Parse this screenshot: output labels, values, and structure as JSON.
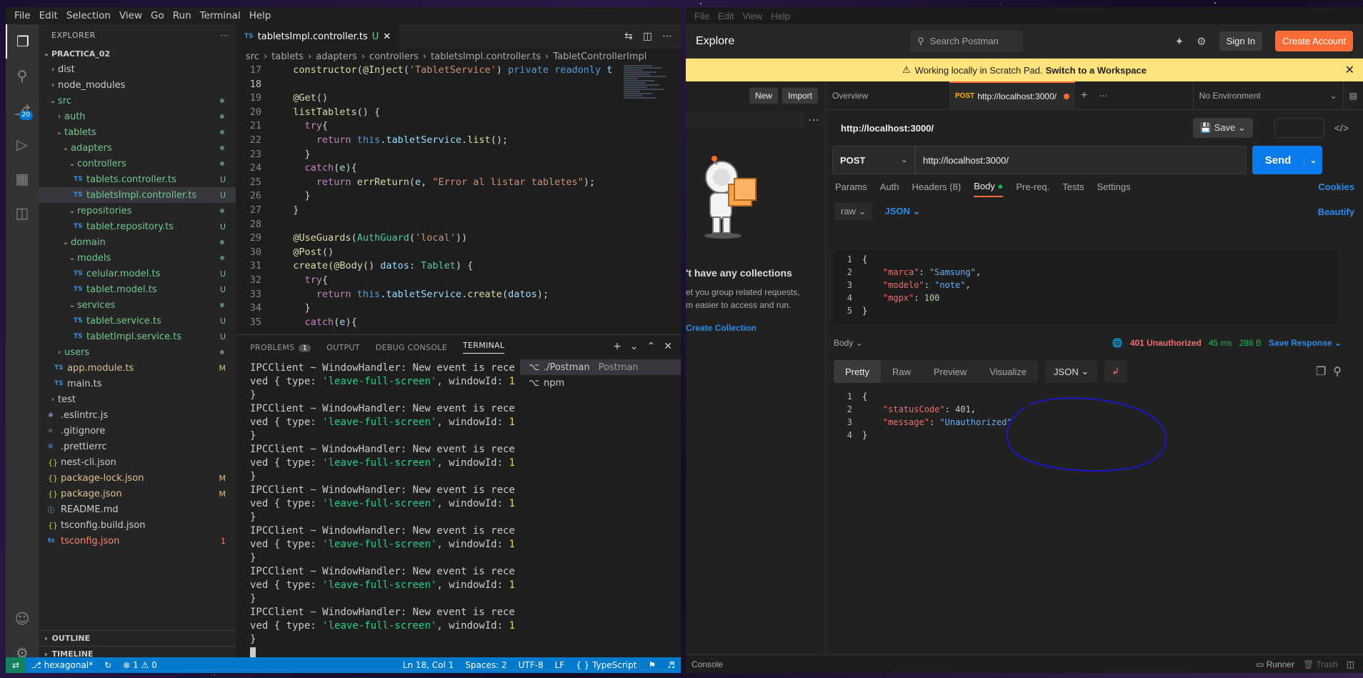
{
  "vscode": {
    "menu": [
      "File",
      "Edit",
      "Selection",
      "View",
      "Go",
      "Run",
      "Terminal",
      "Help"
    ],
    "activity_badge": "20",
    "explorer": {
      "title": "EXPLORER",
      "project": "PRACTICA_02",
      "items": [
        {
          "label": "dist",
          "indent": 1,
          "kind": "folder",
          "open": false,
          "color": "white",
          "status": ""
        },
        {
          "label": "node_modules",
          "indent": 1,
          "kind": "folder",
          "open": false,
          "color": "white",
          "status": ""
        },
        {
          "label": "src",
          "indent": 1,
          "kind": "folder",
          "open": true,
          "color": "green",
          "status": "dot"
        },
        {
          "label": "auth",
          "indent": 2,
          "kind": "folder",
          "open": false,
          "color": "green",
          "status": "dot"
        },
        {
          "label": "tablets",
          "indent": 2,
          "kind": "folder",
          "open": true,
          "color": "green",
          "status": "dot"
        },
        {
          "label": "adapters",
          "indent": 3,
          "kind": "folder",
          "open": true,
          "color": "green",
          "status": "dot"
        },
        {
          "label": "controllers",
          "indent": 4,
          "kind": "folder",
          "open": true,
          "color": "green",
          "status": "dot"
        },
        {
          "label": "tablets.controller.ts",
          "indent": 5,
          "kind": "ts",
          "color": "green",
          "status": "U"
        },
        {
          "label": "tabletsImpl.controller.ts",
          "indent": 5,
          "kind": "ts",
          "color": "green",
          "status": "U",
          "selected": true
        },
        {
          "label": "repositories",
          "indent": 4,
          "kind": "folder",
          "open": true,
          "color": "green",
          "status": "dot"
        },
        {
          "label": "tablet.repository.ts",
          "indent": 5,
          "kind": "ts",
          "color": "green",
          "status": "U"
        },
        {
          "label": "domain",
          "indent": 3,
          "kind": "folder",
          "open": true,
          "color": "green",
          "status": "dot"
        },
        {
          "label": "models",
          "indent": 4,
          "kind": "folder",
          "open": true,
          "color": "green",
          "status": "dot"
        },
        {
          "label": "celular.model.ts",
          "indent": 5,
          "kind": "ts",
          "color": "green",
          "status": "U"
        },
        {
          "label": "tablet.model.ts",
          "indent": 5,
          "kind": "ts",
          "color": "green",
          "status": "U"
        },
        {
          "label": "services",
          "indent": 4,
          "kind": "folder",
          "open": true,
          "color": "green",
          "status": "dot"
        },
        {
          "label": "tablet.service.ts",
          "indent": 5,
          "kind": "ts",
          "color": "green",
          "status": "U"
        },
        {
          "label": "tabletImpl.service.ts",
          "indent": 5,
          "kind": "ts",
          "color": "green",
          "status": "U"
        },
        {
          "label": "users",
          "indent": 2,
          "kind": "folder",
          "open": false,
          "color": "green",
          "status": "dot"
        },
        {
          "label": "app.module.ts",
          "indent": 2,
          "kind": "ts",
          "color": "yellow",
          "status": "M"
        },
        {
          "label": "main.ts",
          "indent": 2,
          "kind": "ts",
          "color": "white",
          "status": ""
        },
        {
          "label": "test",
          "indent": 1,
          "kind": "folder",
          "open": false,
          "color": "white",
          "status": ""
        },
        {
          "label": ".eslintrc.js",
          "indent": 1,
          "kind": "eslint",
          "color": "white",
          "status": ""
        },
        {
          "label": ".gitignore",
          "indent": 1,
          "kind": "git",
          "color": "white",
          "status": ""
        },
        {
          "label": ".prettierrc",
          "indent": 1,
          "kind": "file",
          "color": "white",
          "status": ""
        },
        {
          "label": "nest-cli.json",
          "indent": 1,
          "kind": "json",
          "color": "white",
          "status": ""
        },
        {
          "label": "package-lock.json",
          "indent": 1,
          "kind": "json",
          "color": "yellow",
          "status": "M"
        },
        {
          "label": "package.json",
          "indent": 1,
          "kind": "json",
          "color": "yellow",
          "status": "M"
        },
        {
          "label": "README.md",
          "indent": 1,
          "kind": "info",
          "color": "white",
          "status": ""
        },
        {
          "label": "tsconfig.build.json",
          "indent": 1,
          "kind": "json",
          "color": "white",
          "status": ""
        },
        {
          "label": "tsconfig.json",
          "indent": 1,
          "kind": "tsconfig",
          "color": "red",
          "status": "1"
        }
      ],
      "outline": "OUTLINE",
      "timeline": "TIMELINE"
    },
    "editor": {
      "tab_label": "tabletsImpl.controller.ts",
      "tab_status": "U",
      "breadcrumb": [
        "src",
        "tablets",
        "adapters",
        "controllers",
        "tabletsImpl.controller.ts",
        "TabletControllerImpl"
      ],
      "lines": [
        {
          "n": "17",
          "html": "  <span style='color:#dcdcaa'>constructor</span>(<span style='color:#dcdcaa'>@Inject</span>(<span style='color:#ce9178'>'TabletService'</span>) <span style='color:#569cd6'>private readonly</span> <span style='color:#9cdcfe'>t</span>"
        },
        {
          "n": "18",
          "html": "",
          "current": true
        },
        {
          "n": "19",
          "html": "  <span style='color:#dcdcaa'>@Get</span>()"
        },
        {
          "n": "20",
          "html": "  <span style='color:#dcdcaa'>listTablets</span>() {"
        },
        {
          "n": "21",
          "html": "    <span style='color:#c586c0'>try</span>{"
        },
        {
          "n": "22",
          "html": "      <span style='color:#c586c0'>return</span> <span style='color:#569cd6'>this</span>.<span style='color:#9cdcfe'>tabletService</span>.<span style='color:#dcdcaa'>list</span>();"
        },
        {
          "n": "23",
          "html": "    }"
        },
        {
          "n": "24",
          "html": "    <span style='color:#c586c0'>catch</span>(<span style='color:#9cdcfe'>e</span>){"
        },
        {
          "n": "25",
          "html": "      <span style='color:#c586c0'>return</span> <span style='color:#dcdcaa'>errReturn</span>(<span style='color:#9cdcfe'>e</span>, <span style='color:#ce9178'>\"Error al listar tabletes\"</span>);"
        },
        {
          "n": "26",
          "html": "    }"
        },
        {
          "n": "27",
          "html": "  }"
        },
        {
          "n": "28",
          "html": ""
        },
        {
          "n": "29",
          "html": "  <span style='color:#dcdcaa'>@UseGuards</span>(<span style='color:#4ec9b0'>AuthGuard</span>(<span style='color:#ce9178'>'local'</span>))"
        },
        {
          "n": "30",
          "html": "  <span style='color:#dcdcaa'>@Post</span>()"
        },
        {
          "n": "31",
          "html": "  <span style='color:#dcdcaa'>create</span>(<span style='color:#dcdcaa'>@Body</span>() <span style='color:#9cdcfe'>datos</span>: <span style='color:#4ec9b0'>Tablet</span>) {"
        },
        {
          "n": "32",
          "html": "    <span style='color:#c586c0'>try</span>{"
        },
        {
          "n": "33",
          "html": "      <span style='color:#c586c0'>return</span> <span style='color:#569cd6'>this</span>.<span style='color:#9cdcfe'>tabletService</span>.<span style='color:#dcdcaa'>create</span>(<span style='color:#9cdcfe'>datos</span>);"
        },
        {
          "n": "34",
          "html": "    }"
        },
        {
          "n": "35",
          "html": "    <span style='color:#c586c0'>catch</span>(<span style='color:#9cdcfe'>e</span>){"
        }
      ]
    },
    "panel": {
      "tabs": [
        "PROBLEMS",
        "OUTPUT",
        "DEBUG CONSOLE",
        "TERMINAL"
      ],
      "problems_count": "1",
      "terminal_lines_a": "IPCClient ~ WindowHandler: New event is recei",
      "terminal_lines_b_pre": "ved { type: ",
      "terminal_lines_b_str": "'leave-full-screen'",
      "terminal_lines_b_mid": ", windowId: ",
      "terminal_lines_b_num": "1",
      "terminal_close": "}",
      "terminals": [
        {
          "label": "./Postman",
          "sub": "Postman"
        },
        {
          "label": "npm",
          "sub": ""
        }
      ]
    },
    "status": {
      "branch": "hexagonal*",
      "errors": "1",
      "warnings": "0",
      "position": "Ln 18, Col 1",
      "spaces": "Spaces: 2",
      "encoding": "UTF-8",
      "eol": "LF",
      "language": "TypeScript"
    }
  },
  "postman": {
    "menu": [
      "File",
      "Edit",
      "View",
      "Help"
    ],
    "explore": "Explore",
    "search_placeholder": "Search Postman",
    "sign_in": "Sign In",
    "create_account": "Create Account",
    "banner_text": "Working locally in Scratch Pad.",
    "banner_link": "Switch to a Workspace",
    "new_btn": "New",
    "import_btn": "Import",
    "collections_title": "'t have any collections",
    "collections_desc1": "et you group related requests,",
    "collections_desc2": "m easier to access and run.",
    "create_collection": "Create Collection",
    "tab_overview": "Overview",
    "tab_request_method": "POST",
    "tab_request_url": "http://localhost:3000/",
    "environment": "No Environment",
    "request_title": "http://localhost:3000/",
    "save": "Save",
    "method": "POST",
    "url": "http://localhost:3000/",
    "send": "Send",
    "req_tabs": [
      "Params",
      "Auth",
      "Headers (8)",
      "Body",
      "Pre-req.",
      "Tests",
      "Settings"
    ],
    "cookies": "Cookies",
    "body_mode": "raw",
    "body_lang": "JSON",
    "beautify": "Beautify",
    "request_body": [
      {
        "n": "1",
        "html": "<span class='pm-punc'>{</span>"
      },
      {
        "n": "2",
        "html": "    <span class='pm-key'>\"marca\"</span><span class='pm-punc'>: </span><span class='pm-str'>\"Samsung\"</span><span class='pm-punc'>,</span>"
      },
      {
        "n": "3",
        "html": "    <span class='pm-key'>\"modelo\"</span><span class='pm-punc'>: </span><span class='pm-str'>\"note\"</span><span class='pm-punc'>,</span>"
      },
      {
        "n": "4",
        "html": "    <span class='pm-key'>\"mgpx\"</span><span class='pm-punc'>: </span><span class='pm-num'>100</span>"
      },
      {
        "n": "5",
        "html": "<span class='pm-punc'>}</span>"
      }
    ],
    "response_label": "Body",
    "status": "401 Unauthorized",
    "time": "45 ms",
    "size": "288 B",
    "save_response": "Save Response",
    "resp_tabs": [
      "Pretty",
      "Raw",
      "Preview",
      "Visualize"
    ],
    "resp_lang": "JSON",
    "response_body": [
      {
        "n": "1",
        "html": "<span class='pm-punc'>{</span>"
      },
      {
        "n": "2",
        "html": "    <span class='pm-key'>\"statusCode\"</span><span class='pm-punc'>: </span><span class='pm-num'>401</span><span class='pm-punc'>,</span>"
      },
      {
        "n": "3",
        "html": "    <span class='pm-key'>\"message\"</span><span class='pm-punc'>: </span><span class='pm-str'>\"Unauthorized\"</span>"
      },
      {
        "n": "4",
        "html": "<span class='pm-punc'>}</span>"
      }
    ],
    "console": "Console",
    "runner": "Runner",
    "trash": "Trash"
  }
}
